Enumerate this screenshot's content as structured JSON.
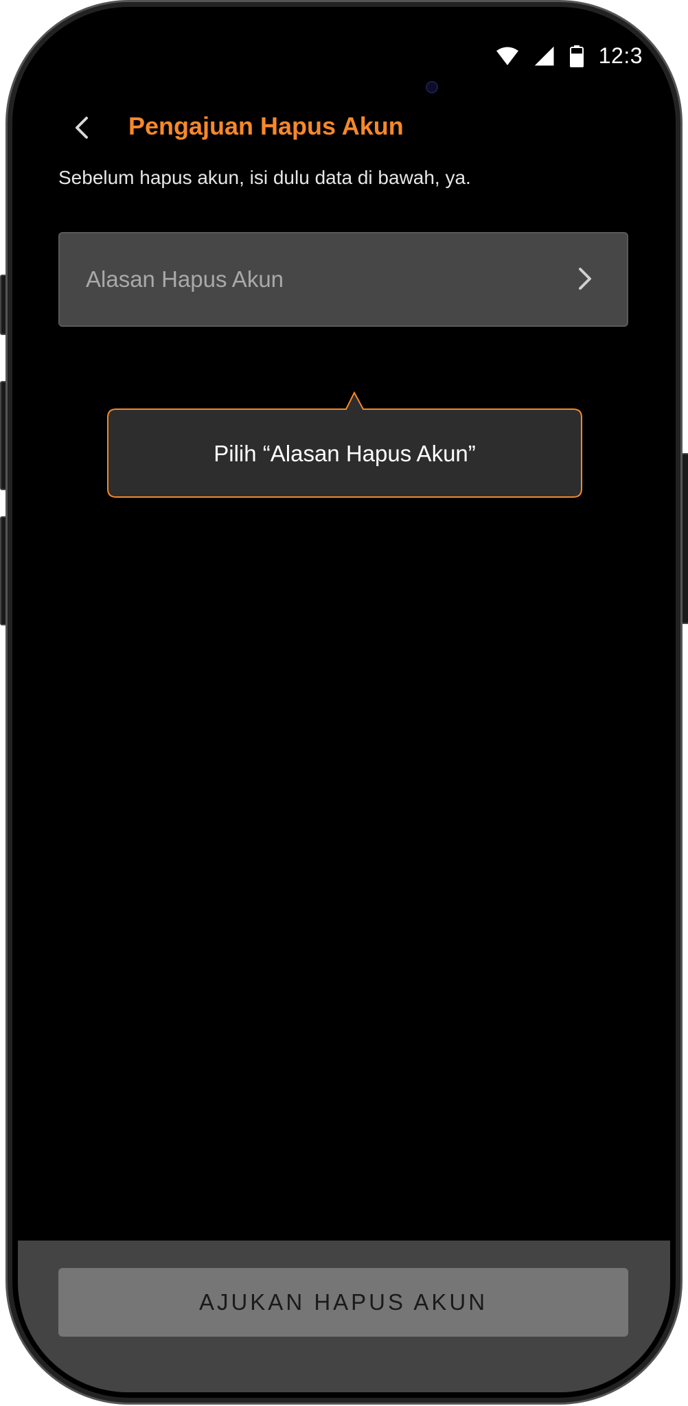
{
  "status_bar": {
    "time": "12:3",
    "icons": [
      "wifi-icon",
      "signal-icon",
      "battery-icon"
    ]
  },
  "header": {
    "back_icon": "chevron-left-icon",
    "title": "Pengajuan Hapus Akun"
  },
  "form": {
    "intro": "Sebelum hapus akun, isi dulu data di bawah, ya.",
    "reason_field": {
      "placeholder": "Alasan Hapus Akun",
      "icon": "chevron-right-icon"
    }
  },
  "tooltip": {
    "text": "Pilih “Alasan Hapus Akun”"
  },
  "footer": {
    "submit_label": "AJUKAN HAPUS AKUN"
  },
  "colors": {
    "accent": "#f7882a",
    "background": "#000000",
    "field_bg": "#474747",
    "button_disabled": "#767676",
    "bottom_bar": "#444444"
  }
}
